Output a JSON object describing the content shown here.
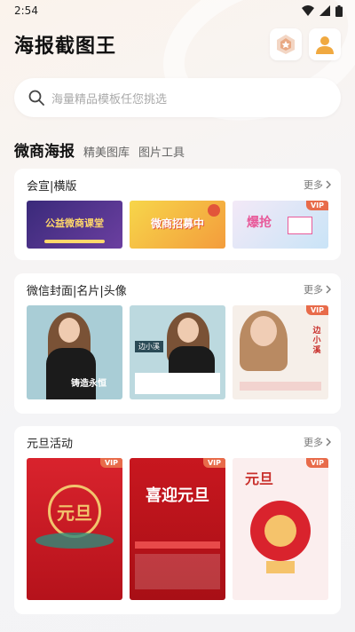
{
  "status": {
    "time": "2:54"
  },
  "header": {
    "title": "海报截图王"
  },
  "search": {
    "placeholder": "海量精品模板任您挑选"
  },
  "tabs": [
    "微商海报",
    "精美图库",
    "图片工具"
  ],
  "sections": [
    {
      "title": "会宣|横版",
      "more": "更多",
      "thumbs": [
        {
          "text": "公益微商课堂",
          "vip": ""
        },
        {
          "text": "微商招募中",
          "vip": ""
        },
        {
          "text": "爆抢",
          "vip": "VIP"
        }
      ]
    },
    {
      "title": "微信封面|名片|头像",
      "more": "更多",
      "thumbs": [
        {
          "text": "铸造永恒",
          "vip": ""
        },
        {
          "text": "边小溪",
          "vip": ""
        },
        {
          "text": "边小溪",
          "vip": "VIP"
        }
      ]
    },
    {
      "title": "元旦活动",
      "more": "更多",
      "thumbs": [
        {
          "text": "元旦",
          "vip": "VIP"
        },
        {
          "text": "喜迎元旦",
          "vip": "VIP"
        },
        {
          "text": "元旦",
          "vip": "VIP"
        }
      ]
    }
  ],
  "colors": {
    "vip": "#e86b4a",
    "accent": "#f0a940"
  }
}
